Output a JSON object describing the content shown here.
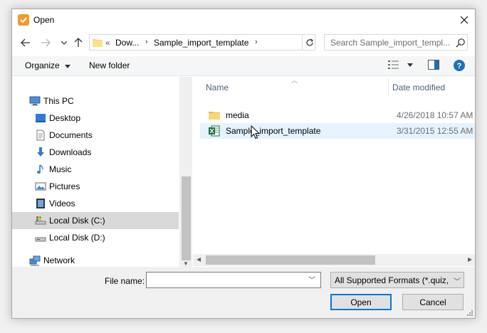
{
  "window": {
    "title": "Open",
    "accent": "#0078d7"
  },
  "nav": {
    "back": "back-arrow",
    "forward": "forward-arrow",
    "recent": "chevron-down",
    "up": "up-arrow"
  },
  "address": {
    "overflow": "«",
    "segments": [
      "Dow...",
      "Sample_import_template"
    ]
  },
  "search": {
    "placeholder": "Search Sample_import_templ..."
  },
  "toolbar": {
    "organize": "Organize",
    "new_folder": "New folder"
  },
  "sidebar": {
    "items": [
      {
        "label": "This PC",
        "icon": "computer-icon"
      },
      {
        "label": "Desktop",
        "icon": "desktop-icon"
      },
      {
        "label": "Documents",
        "icon": "documents-icon"
      },
      {
        "label": "Downloads",
        "icon": "downloads-icon"
      },
      {
        "label": "Music",
        "icon": "music-icon"
      },
      {
        "label": "Pictures",
        "icon": "pictures-icon"
      },
      {
        "label": "Videos",
        "icon": "videos-icon"
      },
      {
        "label": "Local Disk (C:)",
        "icon": "drive-icon",
        "selected": true
      },
      {
        "label": "Local Disk (D:)",
        "icon": "drive-icon"
      },
      {
        "label": "Network",
        "icon": "network-icon"
      }
    ]
  },
  "columns": {
    "name": "Name",
    "date": "Date modified"
  },
  "files": [
    {
      "name": "media",
      "date": "4/26/2018 10:57 AM",
      "icon": "folder-icon"
    },
    {
      "name": "Sample_import_template",
      "date": "3/31/2015 12:55 AM",
      "icon": "excel-icon"
    }
  ],
  "bottom": {
    "file_name_label": "File name:",
    "file_name_value": "",
    "filter": "All Supported Formats (*.quiz, *",
    "open": "Open",
    "cancel": "Cancel"
  }
}
